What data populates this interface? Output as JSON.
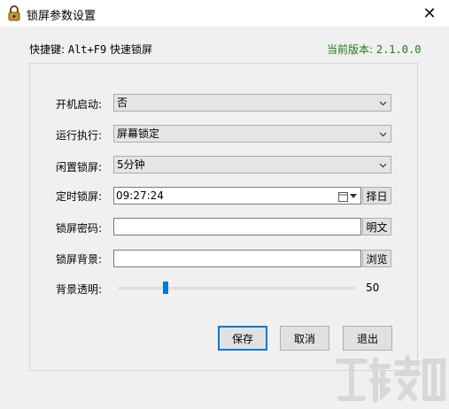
{
  "window": {
    "title": "锁屏参数设置",
    "close_glyph": "✕"
  },
  "header": {
    "hotkey_prefix": "快捷键: ",
    "hotkey_keys": "Alt+F9",
    "hotkey_suffix": " 快速锁屏",
    "version_label": "当前版本: ",
    "version_value": "2.1.0.0"
  },
  "form": {
    "startup": {
      "label": "开机启动:",
      "value": "否"
    },
    "action": {
      "label": "运行执行:",
      "value": "屏幕锁定"
    },
    "idle": {
      "label": "闲置锁屏:",
      "value": "5分钟"
    },
    "timer": {
      "label": "定时锁屏:",
      "value": "09:27:24",
      "button": "择日"
    },
    "password": {
      "label": "锁屏密码:",
      "value": "",
      "button": "明文"
    },
    "background": {
      "label": "锁屏背景:",
      "value": "",
      "button": "浏览"
    },
    "opacity": {
      "label": "背景透明:",
      "value": "50",
      "fraction": 0.2
    }
  },
  "buttons": {
    "save": "保存",
    "cancel": "取消",
    "exit": "退出"
  },
  "colors": {
    "accent": "#0078d7",
    "version_green": "#1a7a1a"
  }
}
